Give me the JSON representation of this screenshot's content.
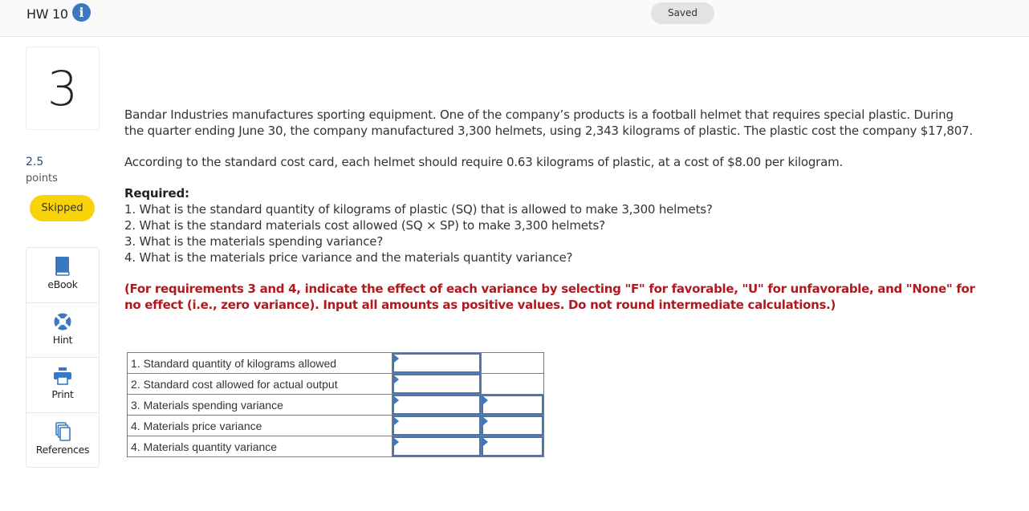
{
  "header": {
    "title": "HW 10",
    "info_icon": "info-icon",
    "save_status": "Saved"
  },
  "question": {
    "number": "3",
    "points_value": "2.5",
    "points_label": "points",
    "status": "Skipped"
  },
  "tools": [
    {
      "label": "eBook",
      "icon": "book-icon"
    },
    {
      "label": "Hint",
      "icon": "lifebuoy-icon"
    },
    {
      "label": "Print",
      "icon": "printer-icon"
    },
    {
      "label": "References",
      "icon": "documents-icon"
    }
  ],
  "problem": {
    "paragraph1": "Bandar Industries manufactures sporting equipment. One of the company’s products is a football helmet that requires special plastic. During the quarter ending June 30, the company manufactured 3,300 helmets, using 2,343 kilograms of plastic. The plastic cost the company $17,807.",
    "paragraph2": "According to the standard cost card, each helmet should require 0.63 kilograms of plastic, at a cost of $8.00 per kilogram.",
    "required_heading": "Required:",
    "requirements": [
      "1. What is the standard quantity of kilograms of plastic (SQ) that is allowed to make 3,300 helmets?",
      "2. What is the standard materials cost allowed (SQ × SP) to make 3,300 helmets?",
      "3. What is the materials spending variance?",
      "4. What is the materials price variance and the materials quantity variance?"
    ],
    "instruction": "(For requirements 3 and 4, indicate the effect of each variance by selecting \"F\" for favorable, \"U\" for unfavorable, and \"None\" for no effect (i.e., zero variance). Input all amounts as positive values. Do not round intermediate calculations.)"
  },
  "answer_table": {
    "rows": [
      {
        "label": "1. Standard quantity of kilograms allowed",
        "amount": "",
        "has_effect": false,
        "effect": ""
      },
      {
        "label": "2. Standard cost allowed for actual output",
        "amount": "",
        "has_effect": false,
        "effect": ""
      },
      {
        "label": "3. Materials spending variance",
        "amount": "",
        "has_effect": true,
        "effect": ""
      },
      {
        "label": "4. Materials price variance",
        "amount": "",
        "has_effect": true,
        "effect": ""
      },
      {
        "label": "4. Materials quantity variance",
        "amount": "",
        "has_effect": true,
        "effect": ""
      }
    ]
  },
  "colors": {
    "accent_blue": "#3a78c2",
    "skipped_yellow": "#f9d30a",
    "instruction_red": "#b0191e",
    "points_blue": "#1f4e86"
  }
}
